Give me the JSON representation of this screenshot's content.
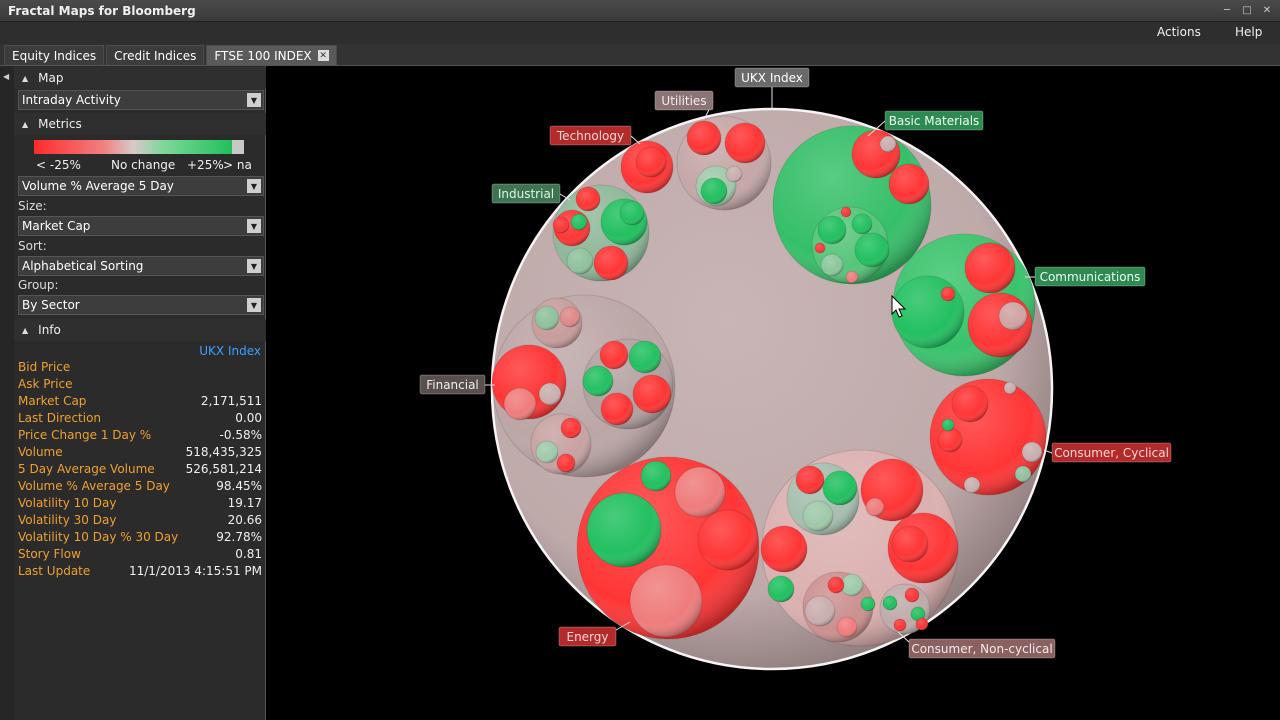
{
  "window": {
    "title": "Fractal Maps for Bloomberg"
  },
  "menu": {
    "actions": "Actions",
    "help": "Help"
  },
  "tabs": [
    {
      "label": "Equity Indices"
    },
    {
      "label": "Credit Indices"
    },
    {
      "label": "FTSE 100 INDEX",
      "active": true
    }
  ],
  "panel": {
    "map": {
      "heading": "Map",
      "view": "Intraday Activity"
    },
    "metrics": {
      "heading": "Metrics",
      "legend_low": "< -25%",
      "legend_mid": "No change",
      "legend_high": "+25%",
      "legend_na": "> na",
      "metric": "Volume % Average 5 Day",
      "size_label": "Size:",
      "size": "Market Cap",
      "sort_label": "Sort:",
      "sort": "Alphabetical Sorting",
      "group_label": "Group:",
      "group": "By Sector"
    },
    "info": {
      "heading": "Info",
      "selected": "UKX Index",
      "rows": [
        {
          "label": "Bid Price",
          "value": ""
        },
        {
          "label": "Ask Price",
          "value": ""
        },
        {
          "label": "Market Cap",
          "value": "2,171,511"
        },
        {
          "label": "Last Direction",
          "value": "0.00"
        },
        {
          "label": "Price Change 1 Day %",
          "value": "-0.58%"
        },
        {
          "label": "Volume",
          "value": "518,435,325"
        },
        {
          "label": "5 Day Average Volume",
          "value": "526,581,214"
        },
        {
          "label": "Volume % Average 5 Day",
          "value": "98.45%"
        },
        {
          "label": "Volatility 10 Day",
          "value": "19.17"
        },
        {
          "label": "Volatility 30 Day",
          "value": "20.66"
        },
        {
          "label": "Volatility 10 Day % 30 Day",
          "value": "92.78%"
        },
        {
          "label": "Story Flow",
          "value": "0.81"
        },
        {
          "label": "Last Update",
          "value": "11/1/2013 4:15:51 PM"
        }
      ]
    }
  },
  "map": {
    "root_label": "UKX Index",
    "sectors": [
      {
        "name": "Utilities",
        "tone": "neutral"
      },
      {
        "name": "Basic Materials",
        "tone": "green"
      },
      {
        "name": "Technology",
        "tone": "red"
      },
      {
        "name": "Industrial",
        "tone": "greenish"
      },
      {
        "name": "Communications",
        "tone": "green"
      },
      {
        "name": "Financial",
        "tone": "neutral"
      },
      {
        "name": "Consumer, Cyclical",
        "tone": "red"
      },
      {
        "name": "Energy",
        "tone": "red"
      },
      {
        "name": "Consumer, Non-cyclical",
        "tone": "neutral"
      }
    ],
    "colors": {
      "red": "#ff3535",
      "green": "#22c060",
      "neutral": "#cdbdbd",
      "pink": "#ef7c7c",
      "grey": "#c9aeae"
    }
  }
}
